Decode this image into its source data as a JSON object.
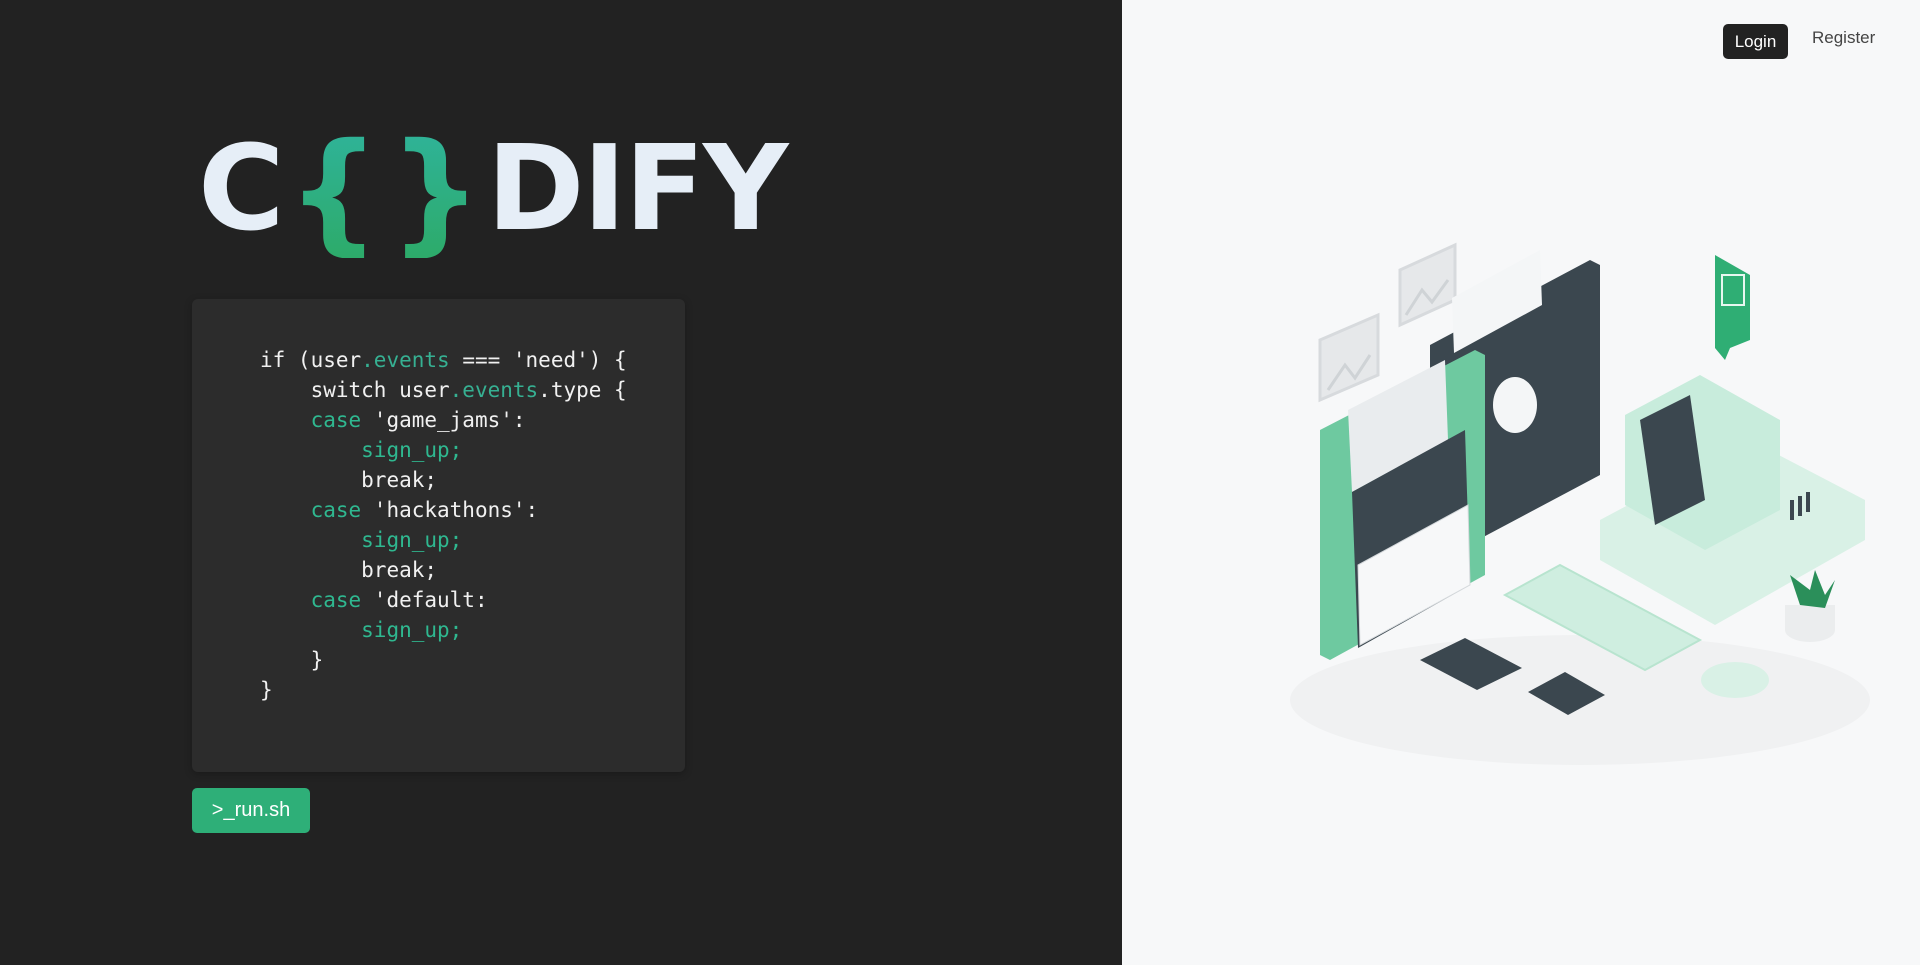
{
  "brand": {
    "logo_prefix": "C",
    "logo_brace_open": "{",
    "logo_brace_close": "}",
    "logo_suffix": "DIFY",
    "logo_text_color": "#e6eef7",
    "accent_gradient": [
      "#2fb39a",
      "#2dab6a"
    ]
  },
  "nav": {
    "login_label": "Login",
    "register_label": "Register"
  },
  "code_snippet": {
    "lines": [
      {
        "indent": "",
        "parts": [
          {
            "t": "if (user",
            "c": "plain"
          },
          {
            "t": ".events",
            "c": "prop"
          },
          {
            "t": " === 'need') {",
            "c": "plain"
          }
        ]
      },
      {
        "indent": "    ",
        "parts": [
          {
            "t": "switch user",
            "c": "plain"
          },
          {
            "t": ".events",
            "c": "prop"
          },
          {
            "t": ".type {",
            "c": "plain"
          }
        ]
      },
      {
        "indent": "    ",
        "parts": [
          {
            "t": "case",
            "c": "green"
          },
          {
            "t": " 'game_jams':",
            "c": "plain"
          }
        ]
      },
      {
        "indent": "        ",
        "parts": [
          {
            "t": "sign_up;",
            "c": "green"
          }
        ]
      },
      {
        "indent": "        ",
        "parts": [
          {
            "t": "break;",
            "c": "plain"
          }
        ]
      },
      {
        "indent": "    ",
        "parts": [
          {
            "t": "case",
            "c": "green"
          },
          {
            "t": " 'hackathons':",
            "c": "plain"
          }
        ]
      },
      {
        "indent": "        ",
        "parts": [
          {
            "t": "sign_up;",
            "c": "green"
          }
        ]
      },
      {
        "indent": "        ",
        "parts": [
          {
            "t": "break;",
            "c": "plain"
          }
        ]
      },
      {
        "indent": "    ",
        "parts": [
          {
            "t": "case",
            "c": "green"
          },
          {
            "t": " 'default:",
            "c": "plain"
          }
        ]
      },
      {
        "indent": "        ",
        "parts": [
          {
            "t": "sign_up;",
            "c": "green"
          }
        ]
      },
      {
        "indent": "    ",
        "parts": [
          {
            "t": "}",
            "c": "plain"
          }
        ]
      },
      {
        "indent": "",
        "parts": [
          {
            "t": "}",
            "c": "plain"
          }
        ]
      }
    ]
  },
  "run_button": {
    "label": ">_run.sh",
    "color": "#2eaf78"
  },
  "illustration": {
    "icon": "retro-computer-floppy-disks-illustration"
  }
}
